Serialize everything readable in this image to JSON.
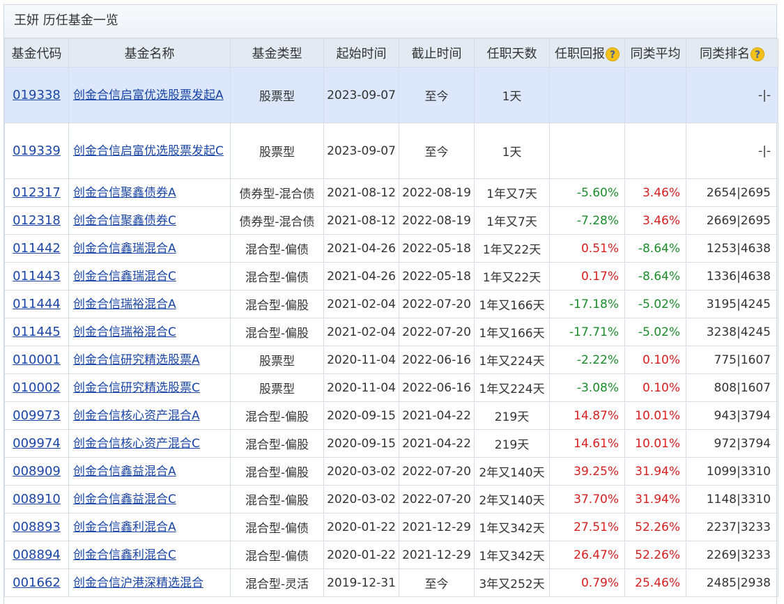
{
  "panel": {
    "title": "王妍 历任基金一览"
  },
  "table": {
    "headers": [
      "基金代码",
      "基金名称",
      "基金类型",
      "起始时间",
      "截止时间",
      "任职天数",
      "任职回报",
      "同类平均",
      "同类排名"
    ],
    "rows": [
      {
        "code": "019338",
        "name": "创金合信启富优选股票发起A",
        "type": "股票型",
        "start": "2023-09-07",
        "end": "至今",
        "days": "1天",
        "ret": "",
        "avg": "",
        "rank": "-|-"
      },
      {
        "code": "019339",
        "name": "创金合信启富优选股票发起C",
        "type": "股票型",
        "start": "2023-09-07",
        "end": "至今",
        "days": "1天",
        "ret": "",
        "avg": "",
        "rank": "-|-"
      },
      {
        "code": "012317",
        "name": "创金合信聚鑫债券A",
        "type": "债券型-混合债",
        "start": "2021-08-12",
        "end": "2022-08-19",
        "days": "1年又7天",
        "ret": "-5.60%",
        "avg": "3.46%",
        "rank": "2654|2695"
      },
      {
        "code": "012318",
        "name": "创金合信聚鑫债券C",
        "type": "债券型-混合债",
        "start": "2021-08-12",
        "end": "2022-08-19",
        "days": "1年又7天",
        "ret": "-7.28%",
        "avg": "3.46%",
        "rank": "2669|2695"
      },
      {
        "code": "011442",
        "name": "创金合信鑫瑞混合A",
        "type": "混合型-偏债",
        "start": "2021-04-26",
        "end": "2022-05-18",
        "days": "1年又22天",
        "ret": "0.51%",
        "avg": "-8.64%",
        "rank": "1253|4638"
      },
      {
        "code": "011443",
        "name": "创金合信鑫瑞混合C",
        "type": "混合型-偏债",
        "start": "2021-04-26",
        "end": "2022-05-18",
        "days": "1年又22天",
        "ret": "0.17%",
        "avg": "-8.64%",
        "rank": "1336|4638"
      },
      {
        "code": "011444",
        "name": "创金合信瑞裕混合A",
        "type": "混合型-偏股",
        "start": "2021-02-04",
        "end": "2022-07-20",
        "days": "1年又166天",
        "ret": "-17.18%",
        "avg": "-5.02%",
        "rank": "3195|4245"
      },
      {
        "code": "011445",
        "name": "创金合信瑞裕混合C",
        "type": "混合型-偏股",
        "start": "2021-02-04",
        "end": "2022-07-20",
        "days": "1年又166天",
        "ret": "-17.71%",
        "avg": "-5.02%",
        "rank": "3238|4245"
      },
      {
        "code": "010001",
        "name": "创金合信研究精选股票A",
        "type": "股票型",
        "start": "2020-11-04",
        "end": "2022-06-16",
        "days": "1年又224天",
        "ret": "-2.22%",
        "avg": "0.10%",
        "rank": "775|1607"
      },
      {
        "code": "010002",
        "name": "创金合信研究精选股票C",
        "type": "股票型",
        "start": "2020-11-04",
        "end": "2022-06-16",
        "days": "1年又224天",
        "ret": "-3.08%",
        "avg": "0.10%",
        "rank": "808|1607"
      },
      {
        "code": "009973",
        "name": "创金合信核心资产混合A",
        "type": "混合型-偏股",
        "start": "2020-09-15",
        "end": "2021-04-22",
        "days": "219天",
        "ret": "14.87%",
        "avg": "10.01%",
        "rank": "943|3794"
      },
      {
        "code": "009974",
        "name": "创金合信核心资产混合C",
        "type": "混合型-偏股",
        "start": "2020-09-15",
        "end": "2021-04-22",
        "days": "219天",
        "ret": "14.61%",
        "avg": "10.01%",
        "rank": "972|3794"
      },
      {
        "code": "008909",
        "name": "创金合信鑫益混合A",
        "type": "混合型-偏股",
        "start": "2020-03-02",
        "end": "2022-07-20",
        "days": "2年又140天",
        "ret": "39.25%",
        "avg": "31.94%",
        "rank": "1099|3310"
      },
      {
        "code": "008910",
        "name": "创金合信鑫益混合C",
        "type": "混合型-偏股",
        "start": "2020-03-02",
        "end": "2022-07-20",
        "days": "2年又140天",
        "ret": "37.70%",
        "avg": "31.94%",
        "rank": "1148|3310"
      },
      {
        "code": "008893",
        "name": "创金合信鑫利混合A",
        "type": "混合型-偏债",
        "start": "2020-01-22",
        "end": "2021-12-29",
        "days": "1年又342天",
        "ret": "27.51%",
        "avg": "52.26%",
        "rank": "2237|3233"
      },
      {
        "code": "008894",
        "name": "创金合信鑫利混合C",
        "type": "混合型-偏债",
        "start": "2020-01-22",
        "end": "2021-12-29",
        "days": "1年又342天",
        "ret": "26.47%",
        "avg": "52.26%",
        "rank": "2269|3233"
      },
      {
        "code": "001662",
        "name": "创金合信沪港深精选混合",
        "type": "混合型-灵活",
        "start": "2019-12-31",
        "end": "至今",
        "days": "3年又252天",
        "ret": "0.79%",
        "avg": "25.46%",
        "rank": "2485|2938"
      }
    ]
  },
  "icons": {
    "help": "question-mark-icon",
    "help_glyph": "?"
  },
  "colors": {
    "positive": "#d81e1e",
    "negative": "#1b8b2a",
    "link": "#1a46a7",
    "highlight_row": "#dde7fb",
    "header_bg": "#e4eaf2"
  }
}
